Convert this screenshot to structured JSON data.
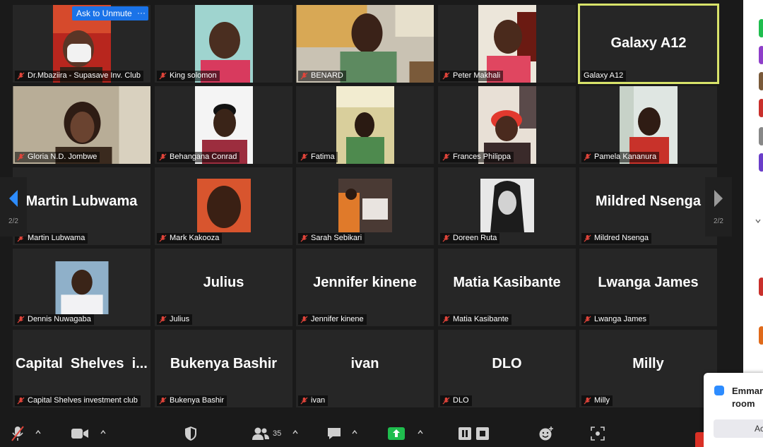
{
  "tiles": [
    {
      "name": "Dr.Mbaziira - Supasave Inv. Club",
      "display": "video"
    },
    {
      "name": "King solomon",
      "display": "video"
    },
    {
      "name": "BENARD",
      "display": "video"
    },
    {
      "name": "Peter Makhali",
      "display": "video"
    },
    {
      "name": "Galaxy A12",
      "display": "Galaxy A12",
      "active": true
    },
    {
      "name": "Gloria N.D. Jombwe",
      "display": "video"
    },
    {
      "name": "Behangana Conrad",
      "display": "video"
    },
    {
      "name": "Fatima",
      "display": "video"
    },
    {
      "name": "Frances Philippa",
      "display": "video"
    },
    {
      "name": "Pamela Kananura",
      "display": "video"
    },
    {
      "name": "Martin Lubwama",
      "display": "Martin Lubwama"
    },
    {
      "name": "Mark Kakooza",
      "display": "photo"
    },
    {
      "name": "Sarah Sebikari",
      "display": "photo"
    },
    {
      "name": "Doreen Ruta",
      "display": "photo"
    },
    {
      "name": "Mildred Nsenga",
      "display": "Mildred Nsenga"
    },
    {
      "name": "Dennis Nuwagaba",
      "display": "photo"
    },
    {
      "name": "Julius",
      "display": "Julius"
    },
    {
      "name": "Jennifer kinene",
      "display": "Jennifer kinene"
    },
    {
      "name": "Matia Kasibante",
      "display": "Matia Kasibante"
    },
    {
      "name": "Lwanga James",
      "display": "Lwanga James"
    },
    {
      "name": "Capital Shelves investment club",
      "display": "Capital  Shelves  i..."
    },
    {
      "name": "Bukenya Bashir",
      "display": "Bukenya Bashir"
    },
    {
      "name": "ivan",
      "display": "ivan"
    },
    {
      "name": "DLO",
      "display": "DLO"
    },
    {
      "name": "Milly",
      "display": "Milly"
    }
  ],
  "overlay": {
    "ask_to_unmute": "Ask to Unmute",
    "more": "···"
  },
  "pagination": {
    "left_page": "2/2",
    "right_page": "2/2"
  },
  "toolbar": {
    "participants_count": "35"
  },
  "notification": {
    "text_line1": "Emmar",
    "text_line2": "room",
    "button_label": "Ac"
  },
  "colors": {
    "active_speaker_border": "#d8e36a",
    "accent_blue": "#1a73e8",
    "muted_red": "#e0443a",
    "share_green": "#1fbd4e"
  }
}
